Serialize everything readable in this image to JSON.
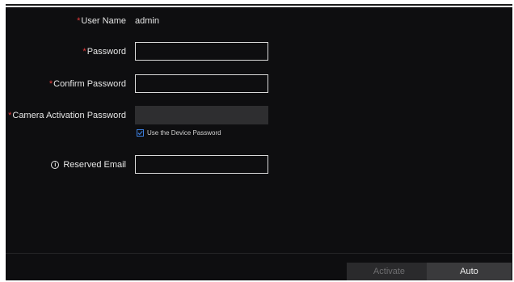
{
  "form": {
    "username": {
      "required_mark": "*",
      "label": "User Name",
      "value": "admin"
    },
    "password": {
      "required_mark": "*",
      "label": "Password",
      "value": ""
    },
    "confirm_password": {
      "required_mark": "*",
      "label": "Confirm Password",
      "value": ""
    },
    "camera_activation_password": {
      "required_mark": "*",
      "label": "Camera Activation Password",
      "value": ""
    },
    "use_device_password": {
      "label": "Use the Device Password",
      "checked": true
    },
    "reserved_email": {
      "label": "Reserved Email",
      "value": ""
    }
  },
  "footer": {
    "activate_label": "Activate",
    "auto_label": "Auto"
  },
  "colors": {
    "background": "#0e0e10",
    "required": "#e23b3b",
    "checkbox_accent": "#3b7ddd"
  }
}
